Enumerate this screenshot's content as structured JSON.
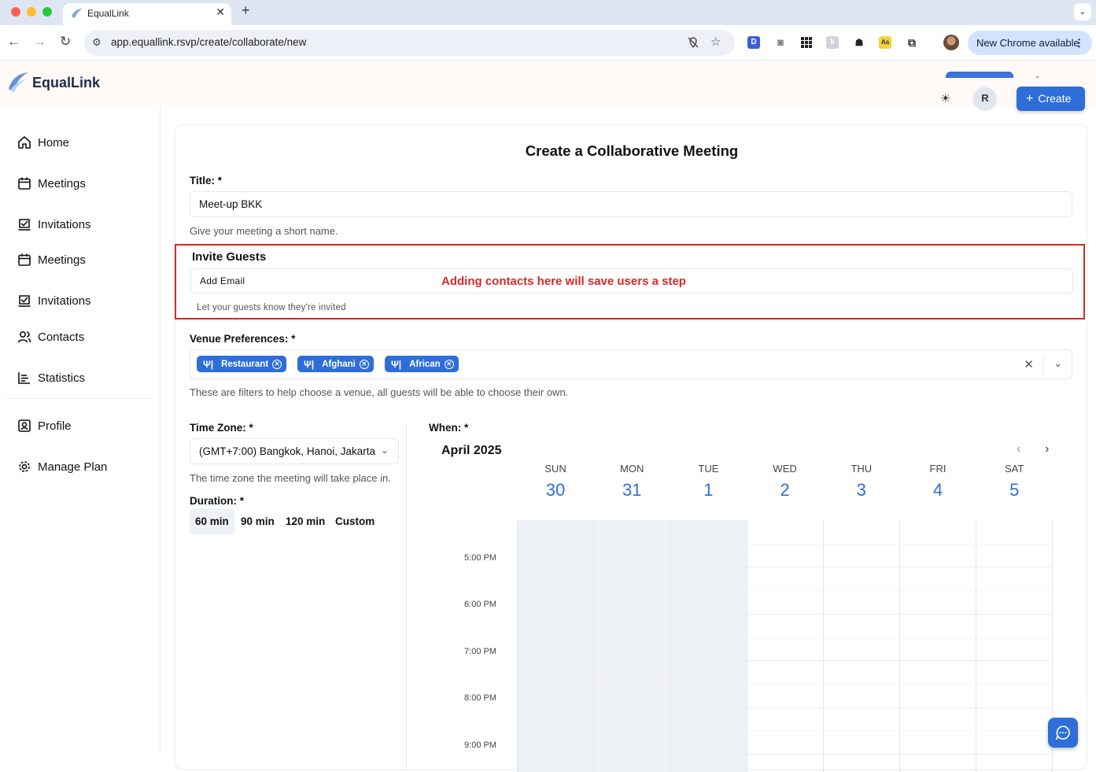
{
  "browser": {
    "tab_title": "EqualLink",
    "url": "app.equallink.rsvp/create/collaborate/new",
    "update_label": "New Chrome available",
    "extensions": [
      "D",
      "Aa"
    ]
  },
  "app": {
    "logo": "EqualLink",
    "avatar_initial": "R",
    "create_label": "Create"
  },
  "sidebar": {
    "items": [
      {
        "label": "Home",
        "icon": "home-icon"
      },
      {
        "label": "Meetings",
        "icon": "calendar-icon"
      },
      {
        "label": "Invitations",
        "icon": "inbox-icon"
      },
      {
        "label": "Meetings",
        "icon": "calendar-icon"
      },
      {
        "label": "Invitations",
        "icon": "inbox-icon"
      },
      {
        "label": "Contacts",
        "icon": "users-icon"
      },
      {
        "label": "Statistics",
        "icon": "chart-icon"
      },
      {
        "label": "Profile",
        "icon": "profile-icon"
      },
      {
        "label": "Manage Plan",
        "icon": "gear-icon"
      }
    ]
  },
  "form": {
    "heading": "Create a Collaborative Meeting",
    "title_label": "Title: *",
    "title_value": "Meet-up BKK",
    "title_hint": "Give your meeting a short name.",
    "invite_label": "Invite Guests",
    "invite_placeholder": "Add Email",
    "invite_hint": "Let your guests know they're invited",
    "annotation": "Adding contacts here will save users a step",
    "venue_label": "Venue Preferences: *",
    "venue_chips": [
      "Restaurant",
      "Afghani",
      "African"
    ],
    "venue_hint": "These are filters to help choose a venue, all guests will be able to choose their own.",
    "timezone_label": "Time Zone: *",
    "timezone_value": "(GMT+7:00) Bangkok, Hanoi, Jakarta",
    "timezone_hint": "The time zone the meeting will take place in.",
    "duration_label": "Duration: *",
    "durations": [
      "60 min",
      "90 min",
      "120 min",
      "Custom"
    ],
    "duration_selected": "60 min",
    "when_label": "When: *"
  },
  "calendar": {
    "month": "April 2025",
    "days": [
      {
        "name": "SUN",
        "num": "30"
      },
      {
        "name": "MON",
        "num": "31"
      },
      {
        "name": "TUE",
        "num": "1"
      },
      {
        "name": "WED",
        "num": "2"
      },
      {
        "name": "THU",
        "num": "3"
      },
      {
        "name": "FRI",
        "num": "4"
      },
      {
        "name": "SAT",
        "num": "5"
      }
    ],
    "times": [
      "5:00 PM",
      "6:00 PM",
      "7:00 PM",
      "8:00 PM",
      "9:00 PM"
    ]
  },
  "colors": {
    "accent": "#2f6ed8",
    "annotation": "#d42a2a"
  }
}
